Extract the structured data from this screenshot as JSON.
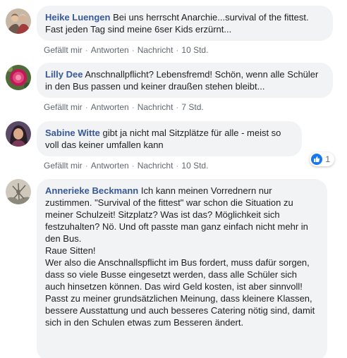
{
  "actions": {
    "like": "Gefällt mir",
    "reply": "Antworten",
    "message": "Nachricht",
    "separator": "·"
  },
  "comments": [
    {
      "author": "Heike Luengen",
      "text": "Bei uns herrscht Anarchie...survival of the fittest. Fast jeden Tag sind meine 6ser Kids erzürnt...",
      "time": "10 Std."
    },
    {
      "author": "Lilly Dee",
      "text": "Anschnallpflicht? Lebensfremd! Schön, wenn alle Schüler in den Bus passen und keiner draußen stehen bleibt...",
      "time": "7 Std."
    },
    {
      "author": "Sabine Witte",
      "text": "gibt ja nicht mal Sitzplätze für alle - meist so voll das keiner umfallen kann",
      "time": "10 Std.",
      "reactions": {
        "icon": "like-icon",
        "count": "1"
      }
    },
    {
      "author": "Annerieke Beckmann",
      "text": "Ich kann meinen Vorrednern nur zustimmen. \"Survival of the fittest\" war schon die Situation zu meiner Schulzeit! Sitzplatz? Was ist das? Möglichkeit sich festzuhalten? Nö. Und oft passte man ganz einfach nicht mehr in den Bus.",
      "text2": "Raue Sitten!",
      "text3": "Wer also die Anschnallspflicht im Bus fordert, muss dafür sorgen, dass so viele Busse eingesetzt werden, dass alle Schüler sich auch hinsetzen können. Das wird Geld kosten, ist aber sinnvoll!",
      "text4": "Passt zu meiner grundsätzlichen Meinung, dass kleinere Klassen, bessere Ausstattung und auch besseres Catering nötig sind, damit sich in den Schulen etwas zum Besseren ändert."
    }
  ]
}
